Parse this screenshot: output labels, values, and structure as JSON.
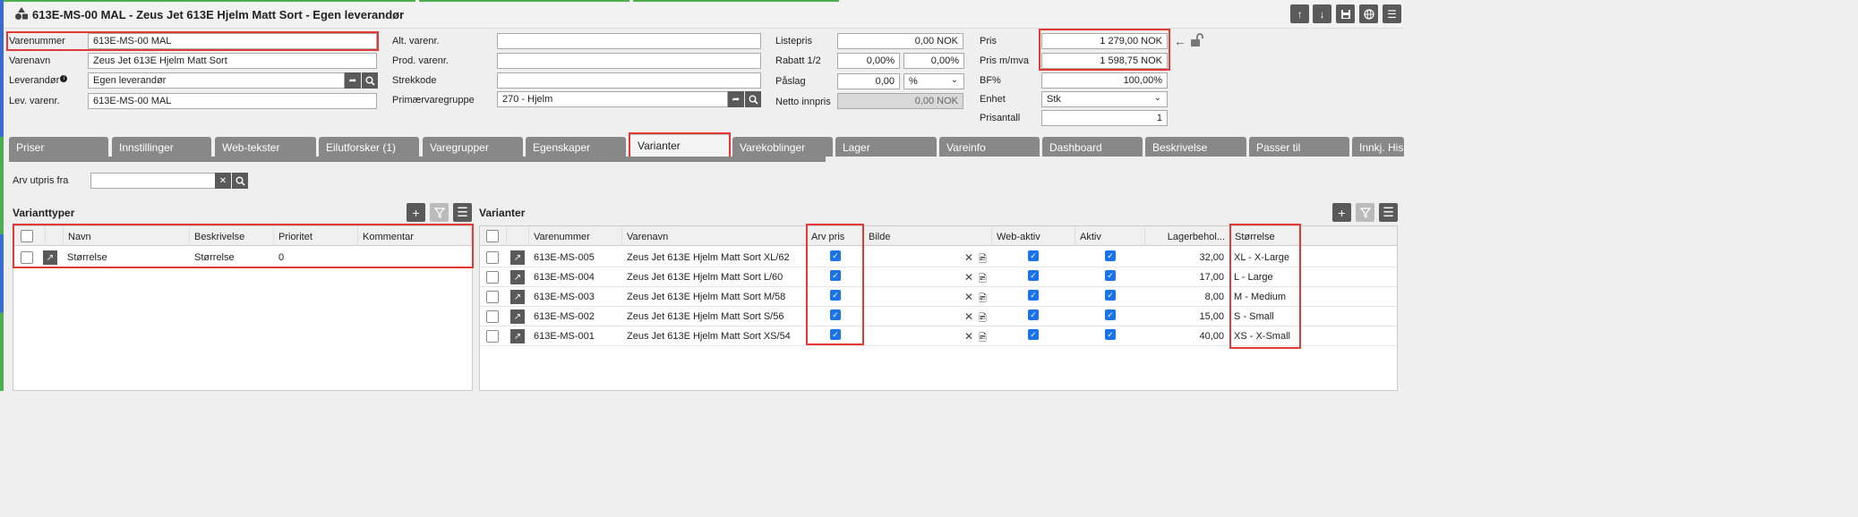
{
  "window": {
    "title": "613E-MS-00 MAL - Zeus Jet 613E Hjelm Matt Sort - Egen leverandør"
  },
  "form": {
    "varenummer": {
      "label": "Varenummer",
      "value": "613E-MS-00 MAL"
    },
    "varenavn": {
      "label": "Varenavn",
      "value": "Zeus Jet 613E Hjelm Matt Sort"
    },
    "leverandor": {
      "label": "Leverandør",
      "value": "Egen leverandør"
    },
    "levvarenr": {
      "label": "Lev. varenr.",
      "value": "613E-MS-00 MAL"
    },
    "altvarenr": {
      "label": "Alt. varenr.",
      "value": ""
    },
    "prodvarenr": {
      "label": "Prod. varenr.",
      "value": ""
    },
    "strekkode": {
      "label": "Strekkode",
      "value": ""
    },
    "primarvaregruppe": {
      "label": "Primærvaregruppe",
      "value": "270 - Hjelm"
    },
    "listepris": {
      "label": "Listepris",
      "value": "0,00 NOK"
    },
    "rabatt": {
      "label": "Rabatt 1/2",
      "value1": "0,00%",
      "value2": "0,00%"
    },
    "paslag": {
      "label": "Påslag",
      "value": "0,00",
      "unit": "%"
    },
    "nettoinnpris": {
      "label": "Netto innpris",
      "value": "0,00 NOK"
    },
    "pris": {
      "label": "Pris",
      "value": "1 279,00 NOK"
    },
    "prismva": {
      "label": "Pris m/mva",
      "value": "1 598,75 NOK"
    },
    "bf": {
      "label": "BF%",
      "value": "100,00%"
    },
    "enhet": {
      "label": "Enhet",
      "value": "Stk"
    },
    "prisantall": {
      "label": "Prisantall",
      "value": "1"
    }
  },
  "tabs": [
    "Priser",
    "Innstillinger",
    "Web-tekster",
    "Eilutforsker (1)",
    "Varegrupper",
    "Egenskaper",
    "Varianter",
    "Varekoblinger",
    "Lager",
    "Vareinfo",
    "Dashboard",
    "Beskrivelse",
    "Passer til",
    "Innkj. His"
  ],
  "arv": {
    "label": "Arv utpris fra",
    "value": ""
  },
  "varianttyper": {
    "title": "Varianttyper",
    "columns": [
      "Navn",
      "Beskrivelse",
      "Prioritet",
      "Kommentar"
    ],
    "rows": [
      {
        "navn": "Størrelse",
        "beskrivelse": "Størrelse",
        "prioritet": "0",
        "kommentar": ""
      }
    ]
  },
  "varianter": {
    "title": "Varianter",
    "columns": [
      "Varenummer",
      "Varenavn",
      "Arv pris",
      "Bilde",
      "Web-aktiv",
      "Aktiv",
      "Lagerbehol...",
      "Størrelse"
    ],
    "rows": [
      {
        "varenummer": "613E-MS-005",
        "varenavn": "Zeus Jet 613E Hjelm Matt Sort XL/62",
        "lager": "32,00",
        "storrelse": "XL - X-Large"
      },
      {
        "varenummer": "613E-MS-004",
        "varenavn": "Zeus Jet 613E Hjelm Matt Sort L/60",
        "lager": "17,00",
        "storrelse": "L - Large"
      },
      {
        "varenummer": "613E-MS-003",
        "varenavn": "Zeus Jet 613E Hjelm Matt Sort M/58",
        "lager": "8,00",
        "storrelse": "M - Medium"
      },
      {
        "varenummer": "613E-MS-002",
        "varenavn": "Zeus Jet 613E Hjelm Matt Sort S/56",
        "lager": "15,00",
        "storrelse": "S - Small"
      },
      {
        "varenummer": "613E-MS-001",
        "varenavn": "Zeus Jet 613E Hjelm Matt Sort XS/54",
        "lager": "40,00",
        "storrelse": "XS - X-Small"
      }
    ]
  },
  "colors": {
    "accent": "#e53935",
    "button": "#5a5a5a",
    "check": "#1a73e8"
  }
}
